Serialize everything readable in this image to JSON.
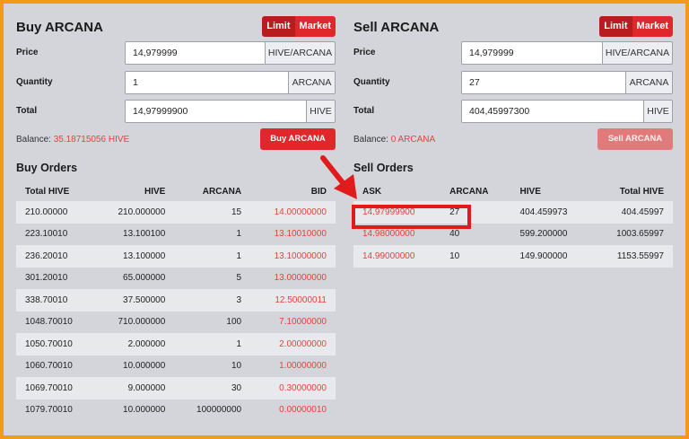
{
  "buy": {
    "title": "Buy ARCANA",
    "mode": {
      "limit": "Limit",
      "market": "Market"
    },
    "price": {
      "label": "Price",
      "value": "14,979999",
      "unit": "HIVE/ARCANA"
    },
    "quantity": {
      "label": "Quantity",
      "value": "1",
      "unit": "ARCANA"
    },
    "total": {
      "label": "Total",
      "value": "14,97999900",
      "unit": "HIVE"
    },
    "balance_label": "Balance:",
    "balance_value": "35.18715056 HIVE",
    "button": "Buy ARCANA"
  },
  "sell": {
    "title": "Sell ARCANA",
    "mode": {
      "limit": "Limit",
      "market": "Market"
    },
    "price": {
      "label": "Price",
      "value": "14,979999",
      "unit": "HIVE/ARCANA"
    },
    "quantity": {
      "label": "Quantity",
      "value": "27",
      "unit": "ARCANA"
    },
    "total": {
      "label": "Total",
      "value": "404,45997300",
      "unit": "HIVE"
    },
    "balance_label": "Balance:",
    "balance_value": "0 ARCANA",
    "button": "Sell ARCANA"
  },
  "buy_orders": {
    "title": "Buy Orders",
    "columns": [
      "Total HIVE",
      "HIVE",
      "ARCANA",
      "BID"
    ],
    "rows": [
      [
        "210.00000",
        "210.000000",
        "15",
        "14.00000000"
      ],
      [
        "223.10010",
        "13.100100",
        "1",
        "13.10010000"
      ],
      [
        "236.20010",
        "13.100000",
        "1",
        "13.10000000"
      ],
      [
        "301.20010",
        "65.000000",
        "5",
        "13.00000000"
      ],
      [
        "338.70010",
        "37.500000",
        "3",
        "12.50000011"
      ],
      [
        "1048.70010",
        "710.000000",
        "100",
        "7.10000000"
      ],
      [
        "1050.70010",
        "2.000000",
        "1",
        "2.00000000"
      ],
      [
        "1060.70010",
        "10.000000",
        "10",
        "1.00000000"
      ],
      [
        "1069.70010",
        "9.000000",
        "30",
        "0.30000000"
      ],
      [
        "1079.70010",
        "10.000000",
        "100000000",
        "0.00000010"
      ]
    ]
  },
  "sell_orders": {
    "title": "Sell Orders",
    "columns": [
      "ASK",
      "ARCANA",
      "HIVE",
      "Total HIVE"
    ],
    "rows": [
      [
        "14.97999900",
        "27",
        "404.459973",
        "404.45997"
      ],
      [
        "14.98000000",
        "40",
        "599.200000",
        "1003.65997"
      ],
      [
        "14.99000000",
        "10",
        "149.900000",
        "1153.55997"
      ]
    ]
  },
  "colors": {
    "accent": "#e0272b",
    "border": "#f39a1d",
    "highlight": "#e11b1b"
  },
  "annotation": {
    "arrow": "arrow-down-right-icon",
    "highlighted_row": 0
  }
}
